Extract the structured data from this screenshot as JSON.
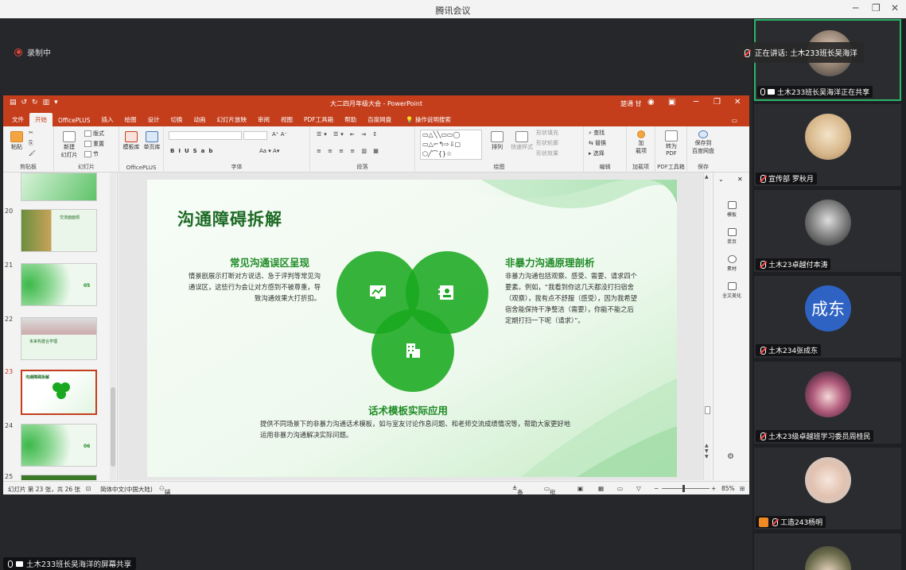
{
  "window": {
    "title": "腾讯会议"
  },
  "recording": {
    "label": "录制中"
  },
  "share_banner": {
    "label": "土木233班长吴海洋的屏幕共享"
  },
  "speaking": {
    "label": "正在讲话: 土木233班长吴海洋"
  },
  "ppt": {
    "doc_title": "大二四月年级大会 - PowerPoint",
    "user": "楚通 甘",
    "tabs": [
      "文件",
      "开始",
      "OfficePLUS",
      "插入",
      "绘图",
      "设计",
      "切换",
      "动画",
      "幻灯片放映",
      "审阅",
      "视图",
      "PDF工具箱",
      "帮助",
      "百度网盘"
    ],
    "active_tab": "开始",
    "search": "操作说明搜索",
    "ribbon": {
      "clipboard": {
        "paste": "粘贴",
        "group": "剪贴板"
      },
      "slides": {
        "new": "新建",
        "new2": "幻灯片",
        "layout": "版式",
        "reset": "重置",
        "section": "节",
        "group": "幻灯片"
      },
      "officeplus": {
        "template": "模板库",
        "single": "单页库",
        "group": "OfficePLUS"
      },
      "font": {
        "group": "字体"
      },
      "paragraph": {
        "group": "段落"
      },
      "drawing": {
        "arrange": "排列",
        "quickstyle": "快速样式",
        "fill": "形状填充",
        "outline": "形状轮廓",
        "effect": "形状效果",
        "group": "绘图"
      },
      "editing": {
        "find": "查找",
        "replace": "替换",
        "select": "选择",
        "group": "编辑"
      },
      "addins": {
        "add": "加",
        "add2": "载项",
        "group": "加载项"
      },
      "pdf": {
        "convert": "转为",
        "convert2": "PDF",
        "group": "PDF工具箱"
      },
      "save": {
        "save": "保存到",
        "save2": "百度网盘",
        "group": "保存"
      }
    },
    "thumbnails": [
      {
        "num": "20",
        "label": "交流面面观"
      },
      {
        "num": "21",
        "label": "05"
      },
      {
        "num": "22",
        "label": "未来构建合学理"
      },
      {
        "num": "23",
        "label": "沟通障碍拆解"
      },
      {
        "num": "24",
        "label": "06"
      },
      {
        "num": "25",
        "label": ""
      }
    ],
    "right_panel": [
      "模板",
      "单页",
      "素材",
      "全文美化"
    ],
    "status": {
      "slide": "幻灯片 第 23 张，共 26 张",
      "lang": "简体中文(中国大陆)",
      "access": "辅助功能: 调查",
      "notes": "备注",
      "comments": "批注",
      "zoom": "85%"
    },
    "slide": {
      "title": "沟通障碍拆解",
      "left_heading": "常见沟通误区呈现",
      "left_text": "情景剧展示打断对方说话、急于评判等常见沟通误区，这些行为会让对方感到不被尊重，导致沟通效果大打折扣。",
      "right_heading": "非暴力沟通原理剖析",
      "right_text": "非暴力沟通包括观察、感受、需要、请求四个要素。例如，“我看到你这几天都没打扫宿舍（观察），我有点不舒服（感受），因为我希望宿舍能保持干净整洁（需要），你能不能之后定期打扫一下呢（请求）”。",
      "bottom_heading": "话术模板实际应用",
      "bottom_text": "提供不同场景下的非暴力沟通话术模板，如与室友讨论作息问题、和老师交流成绩情况等，帮助大家更好地运用非暴力沟通解决实际问题。"
    }
  },
  "participants": [
    {
      "name": "土木233班长吴海洋正在共享"
    },
    {
      "name": "宣传部 罗秋月"
    },
    {
      "name": "土木23卓越付本涛"
    },
    {
      "name": "土木234张成东",
      "avatar_text": "成东"
    },
    {
      "name": "土木23级卓越班学习委员周桂民"
    },
    {
      "name": "工造243杨明"
    },
    {
      "name": ""
    }
  ],
  "colors": {
    "ppt_red": "#c43e1c",
    "slide_green": "#1aa820",
    "title_green": "#1d6a24",
    "speaker_border": "#2db56a",
    "avatar_blue": "#2e63c4"
  }
}
